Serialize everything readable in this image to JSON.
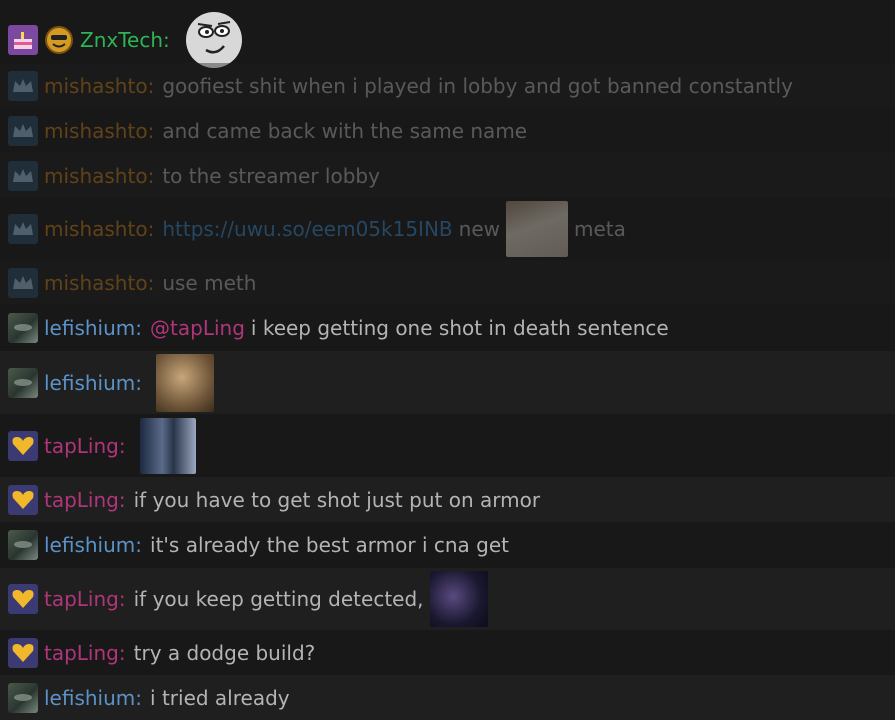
{
  "messages": [
    {
      "user": "ZnxTech",
      "text": "",
      "emote": "rage-face-emote"
    },
    {
      "user": "mishashto",
      "text": "goofiest shit when i played in lobby and got banned constantly"
    },
    {
      "user": "mishashto",
      "text": "and came back with the same name"
    },
    {
      "user": "mishashto",
      "text": "to the streamer lobby"
    },
    {
      "user": "mishashto",
      "link": "https://uwu.so/eem05k15INB",
      "text": "new",
      "emote": "anime-girl-emote",
      "text_after": "meta"
    },
    {
      "user": "mishashto",
      "text": "use meth"
    },
    {
      "user": "lefishium",
      "mention": "@tapLing",
      "text": "i keep getting one shot in death sentence"
    },
    {
      "user": "lefishium",
      "text": "",
      "emote": "pushing-stone-emote"
    },
    {
      "user": "tapLing",
      "text": "",
      "emote": "two-men-emote"
    },
    {
      "user": "tapLing",
      "text": "if you have to get shot just put on armor"
    },
    {
      "user": "lefishium",
      "text": "it's already the best armor i cna get"
    },
    {
      "user": "tapLing",
      "text": "if you keep getting detected,",
      "emote": "dark-figure-emote"
    },
    {
      "user": "tapLing",
      "text": "try a dodge build?"
    },
    {
      "user": "lefishium",
      "text": "i tried already"
    }
  ],
  "colors": {
    "background": "#181818",
    "background_alt": "#1f1f1f",
    "mishashto": "#c77d1a",
    "lefishium": "#5b93c8",
    "tapLing": "#b0357a",
    "ZnxTech": "#2fb455",
    "link": "#3b87c8",
    "text": "#b4b4b4"
  },
  "icons": [
    "cake-badge-icon",
    "coin-face-badge-icon",
    "crown-badge-icon",
    "avatar-badge-icon",
    "heart-badge-icon"
  ]
}
